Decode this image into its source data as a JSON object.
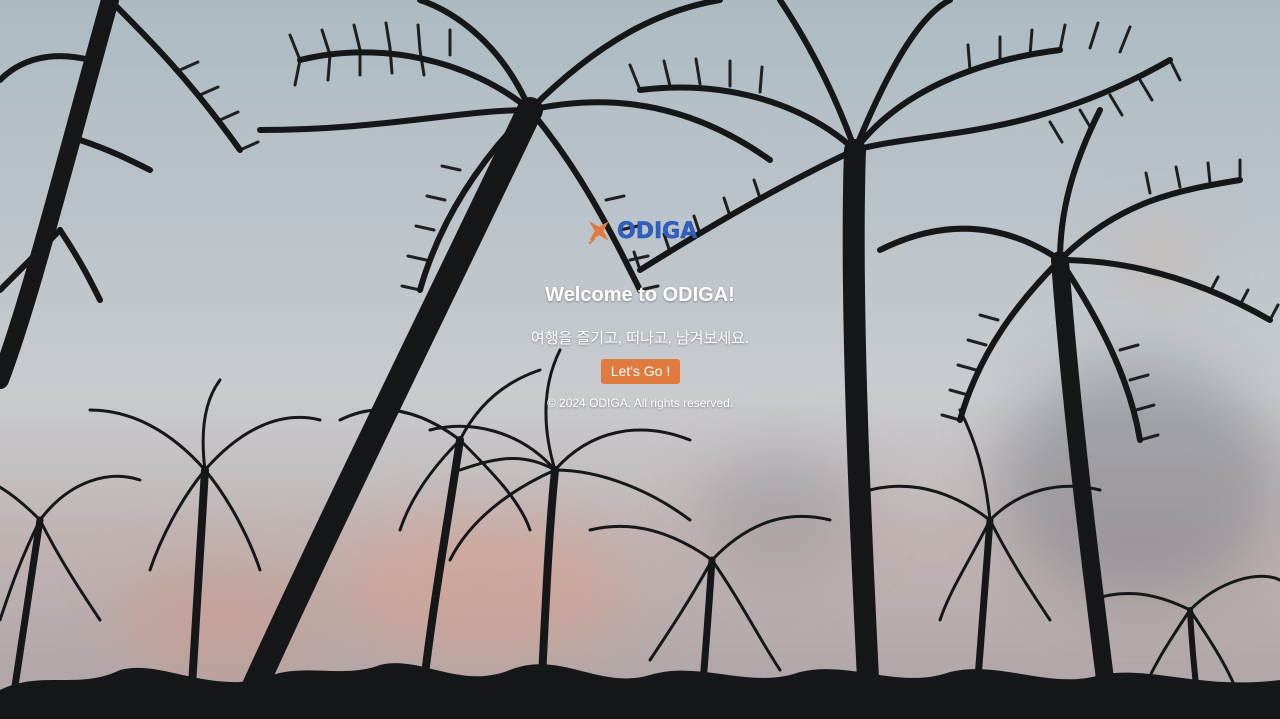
{
  "hero": {
    "background": "palm-trees-sunset-photo",
    "logo": {
      "icon": "airplane-icon",
      "text": "ODIGA",
      "text_color": "#2f5fbf",
      "icon_color": "#e07a3f"
    },
    "title": "Welcome to ODIGA!",
    "subtitle": "여행을 즐기고, 떠나고, 남겨보세요.",
    "cta_label": "Let's Go !",
    "cta_color": "#e07a3f",
    "footer": "© 2024 ODIGA. All rights reserved."
  }
}
